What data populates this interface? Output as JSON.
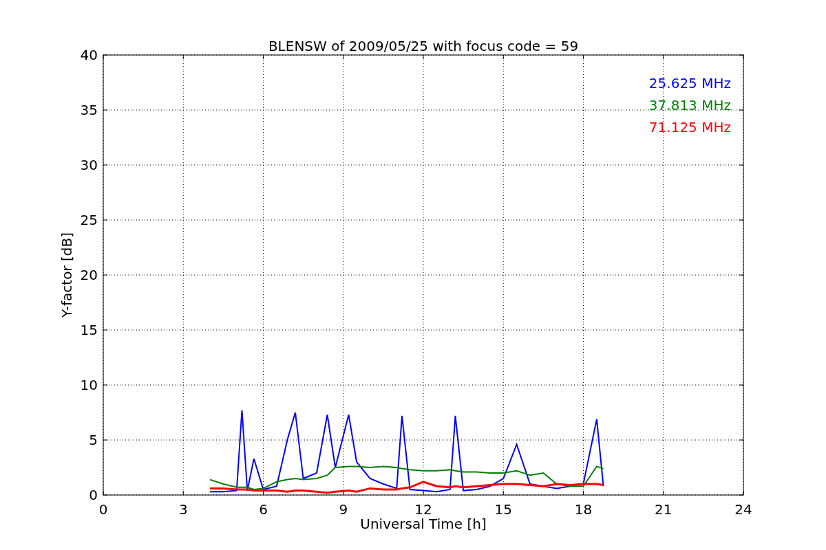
{
  "chart_data": {
    "type": "line",
    "title": "BLENSW of 2009/05/25 with focus code = 59",
    "xlabel": "Universal Time [h]",
    "ylabel": "Y-factor [dB]",
    "x": [
      4.0,
      4.5,
      5.0,
      5.2,
      5.4,
      5.65,
      6.0,
      6.5,
      6.9,
      7.2,
      7.5,
      8.0,
      8.4,
      8.7,
      9.2,
      9.5,
      10.0,
      10.5,
      11.0,
      11.2,
      11.5,
      12.0,
      12.5,
      13.0,
      13.2,
      13.5,
      14.0,
      14.5,
      15.0,
      15.5,
      16.0,
      16.5,
      17.0,
      17.5,
      18.0,
      18.5,
      18.75
    ],
    "series": [
      {
        "name": "25.625 MHz",
        "color": "#0000ff",
        "values": [
          0.3,
          0.3,
          0.4,
          7.7,
          0.4,
          3.3,
          0.5,
          0.8,
          5.0,
          7.5,
          1.5,
          2.0,
          7.3,
          2.5,
          7.3,
          3.0,
          1.5,
          1.0,
          0.6,
          7.2,
          0.5,
          0.4,
          0.3,
          0.5,
          7.2,
          0.4,
          0.5,
          0.8,
          1.5,
          4.6,
          1.0,
          0.8,
          0.6,
          0.8,
          1.0,
          6.9,
          0.8
        ]
      },
      {
        "name": "37.813 MHz",
        "color": "#008000",
        "values": [
          1.4,
          1.0,
          0.7,
          0.7,
          0.7,
          0.5,
          0.6,
          1.2,
          1.4,
          1.5,
          1.4,
          1.5,
          1.8,
          2.5,
          2.6,
          2.6,
          2.5,
          2.6,
          2.5,
          2.4,
          2.3,
          2.2,
          2.2,
          2.3,
          2.2,
          2.1,
          2.1,
          2.0,
          2.0,
          2.2,
          1.8,
          2.0,
          1.0,
          0.8,
          0.8,
          2.6,
          2.4
        ]
      },
      {
        "name": "71.125 MHz",
        "color": "#ff0000",
        "values": [
          0.6,
          0.6,
          0.5,
          0.5,
          0.5,
          0.4,
          0.4,
          0.4,
          0.3,
          0.4,
          0.4,
          0.3,
          0.2,
          0.3,
          0.4,
          0.3,
          0.6,
          0.5,
          0.5,
          0.6,
          0.7,
          1.2,
          0.8,
          0.7,
          0.8,
          0.7,
          0.8,
          0.9,
          1.0,
          1.0,
          0.9,
          0.8,
          1.0,
          0.9,
          1.0,
          1.0,
          0.9
        ]
      }
    ],
    "grid": true,
    "xlim": [
      0,
      24
    ],
    "ylim": [
      0,
      40
    ],
    "xticks": [
      0,
      3,
      6,
      9,
      12,
      15,
      18,
      21,
      24
    ],
    "yticks": [
      0,
      5,
      10,
      15,
      20,
      25,
      30,
      35,
      40
    ]
  }
}
